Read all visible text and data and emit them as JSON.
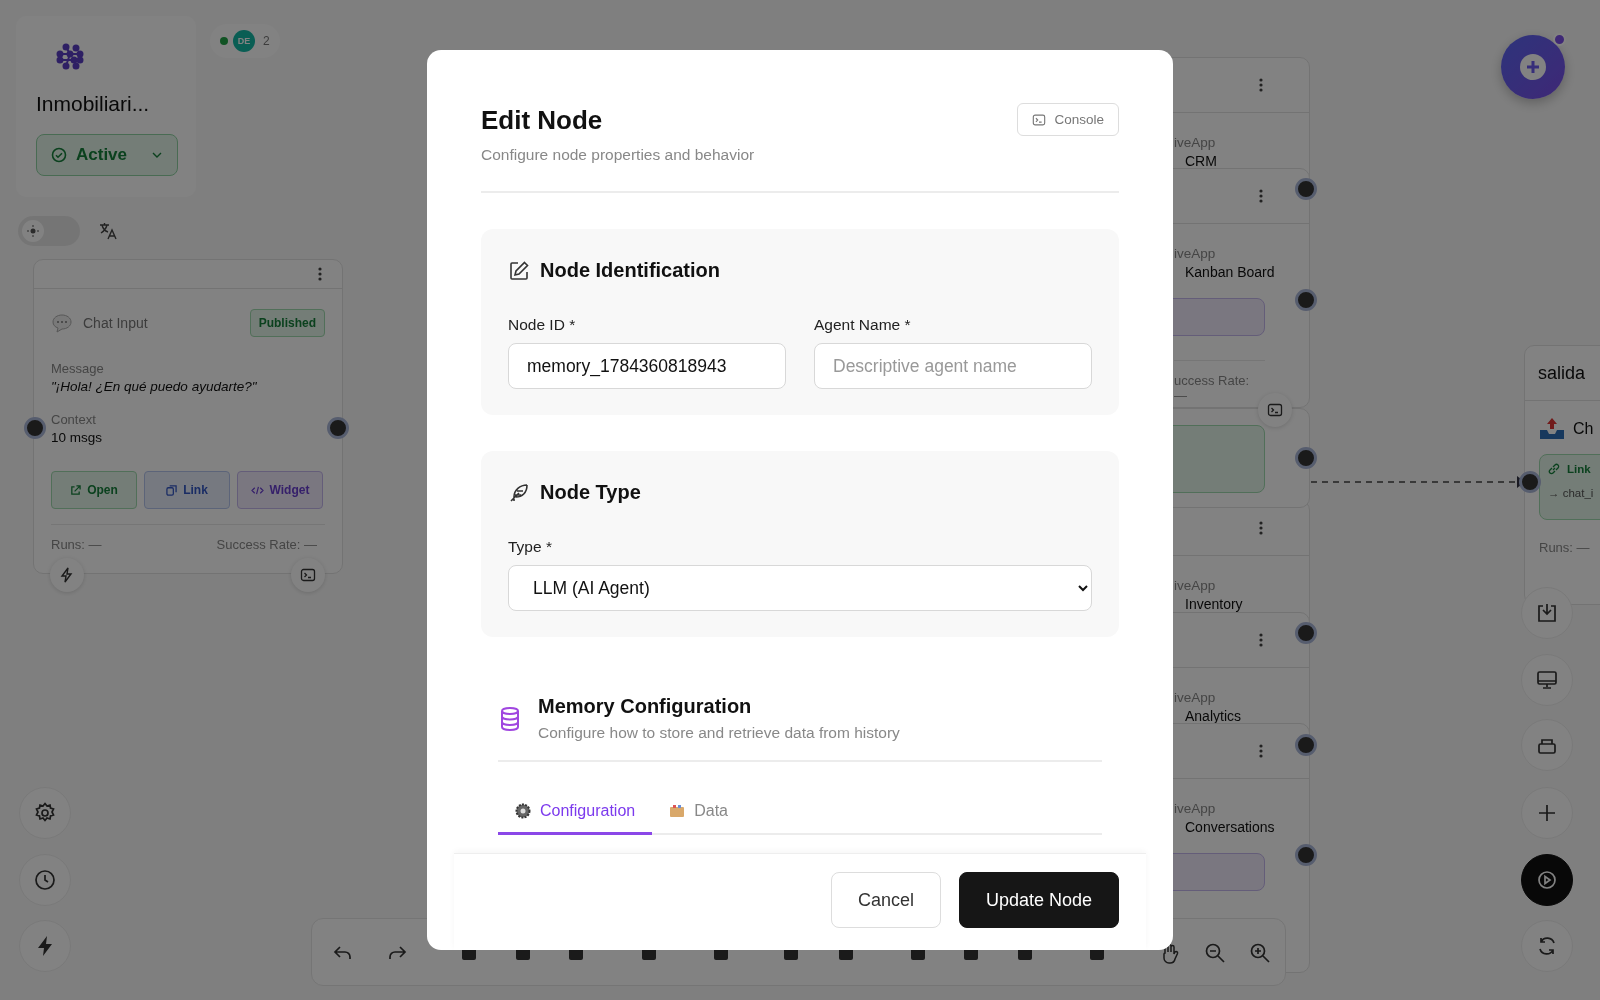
{
  "project": {
    "name": "Inmobiliari...",
    "status": "Active"
  },
  "presence": {
    "initials": "DE",
    "count": "2"
  },
  "theme_toggle": {
    "on": false
  },
  "chat_node": {
    "title": "Chat Input",
    "badge": "Published",
    "fields": [
      {
        "label": "Message",
        "value": "\"¡Hola! ¿En qué puedo ayudarte?\"",
        "kind": "quote"
      },
      {
        "label": "Context",
        "value": "10 msgs",
        "kind": "plain"
      }
    ],
    "buttons": [
      {
        "label": "Open",
        "kind": "open"
      },
      {
        "label": "Link",
        "kind": "link"
      },
      {
        "label": "Widget",
        "kind": "widget"
      }
    ],
    "stats": [
      "Runs: —",
      "Success Rate: —"
    ]
  },
  "column_nodes": [
    {
      "source": "iveApp",
      "name": "CRM"
    },
    {
      "source": "iveApp",
      "name": "Kanban Board",
      "stat": "uccess Rate: —"
    },
    {
      "source": "iveApp",
      "name": "Inventory"
    },
    {
      "source": "iveApp",
      "name": "Analytics"
    },
    {
      "source": "iveApp",
      "name": "Conversations"
    }
  ],
  "output_node": {
    "title": "salida",
    "name": "Ch",
    "link": "Link",
    "target": "→ chat_i",
    "stat": "Runs: —"
  },
  "modal": {
    "title": "Edit Node",
    "subtitle": "Configure node properties and behavior",
    "console_button": "Console",
    "sections": [
      {
        "kind": "identification",
        "title": "Node Identification",
        "fields": [
          {
            "label": "Node ID *",
            "value": "memory_1784360818943",
            "kind": "text"
          },
          {
            "label": "Agent Name *",
            "placeholder": "Descriptive agent name",
            "kind": "text"
          }
        ]
      },
      {
        "kind": "type",
        "title": "Node Type",
        "fields": [
          {
            "label": "Type *",
            "value": "LLM (AI Agent)",
            "kind": "select"
          }
        ]
      }
    ],
    "memory": {
      "title": "Memory Configuration",
      "subtitle": "Configure how to store and retrieve data from history"
    },
    "tabs": [
      {
        "label": "Configuration",
        "selected": true,
        "kind": "gear"
      },
      {
        "label": "Data",
        "selected": false,
        "kind": "box"
      }
    ],
    "buttons": [
      {
        "label": "Cancel",
        "kind": "secondary"
      },
      {
        "label": "Update Node",
        "kind": "primary"
      }
    ]
  }
}
